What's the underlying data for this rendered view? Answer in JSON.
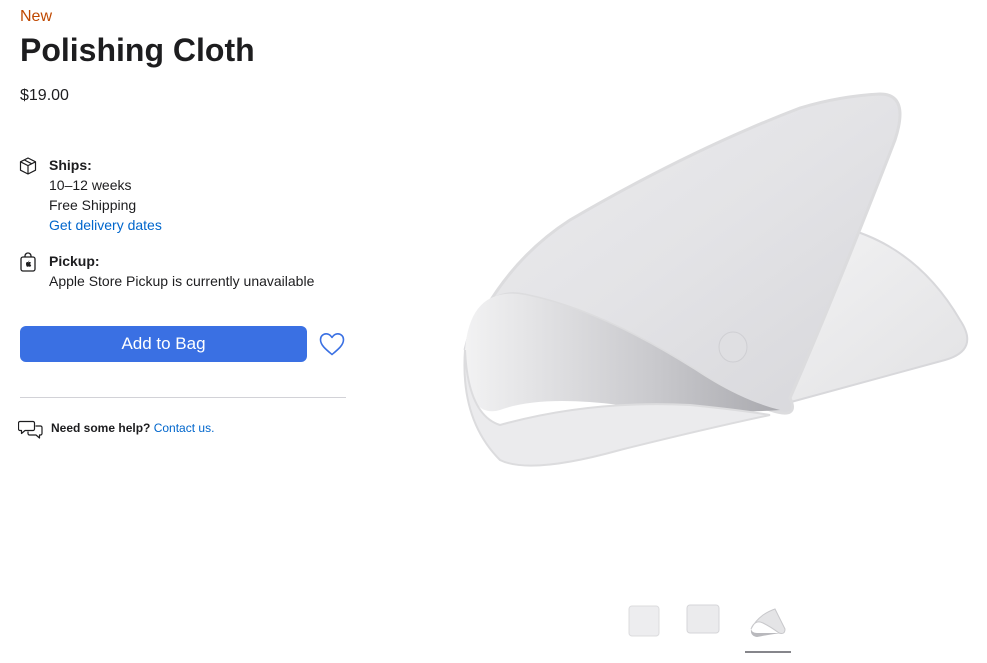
{
  "product": {
    "badge": "New",
    "name": "Polishing Cloth",
    "price": "$19.00"
  },
  "shipping": {
    "label": "Ships:",
    "timeframe": "10–12 weeks",
    "cost": "Free Shipping",
    "delivery_link": "Get delivery dates",
    "icon": "box-icon"
  },
  "pickup": {
    "label": "Pickup:",
    "status": "Apple Store Pickup is currently unavailable",
    "icon": "shopping-bag-icon"
  },
  "actions": {
    "add_to_bag": "Add to Bag",
    "favorite_icon": "heart-icon"
  },
  "help": {
    "prompt": "Need some help?",
    "contact_link": "Contact us.",
    "icon": "chat-bubbles-icon"
  },
  "gallery": {
    "thumbnails": [
      "cloth-flat-front",
      "cloth-flat-angled",
      "cloth-folded"
    ],
    "selected_index": 2
  },
  "colors": {
    "badge": "#bf4800",
    "button": "#3a70e3",
    "link": "#0066cc",
    "text": "#1d1d1f"
  }
}
